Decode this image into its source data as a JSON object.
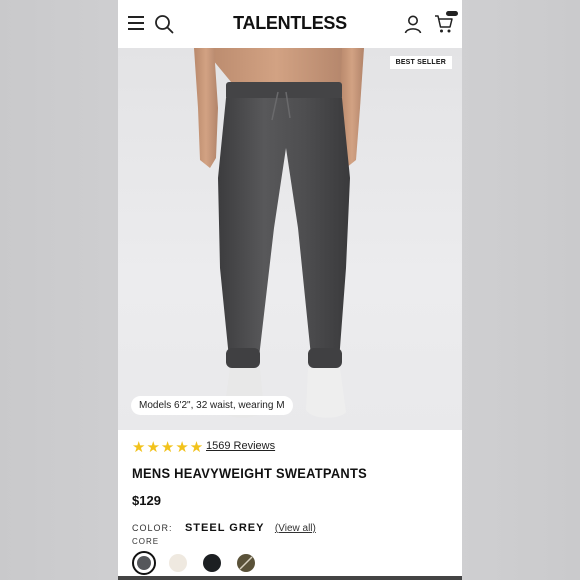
{
  "header": {
    "logo": "TALENTLESS",
    "menu_icon": "hamburger-icon",
    "search_icon": "search-icon",
    "account_icon": "account-icon",
    "cart_icon": "cart-icon"
  },
  "hero": {
    "badge": "BEST SELLER",
    "model_info": "Models 6'2\", 32 waist, wearing M"
  },
  "product": {
    "stars": "★★★★★",
    "rating": 5,
    "reviews_link": "1569 Reviews",
    "title": "MENS HEAVYWEIGHT SWEATPANTS",
    "price": "$129",
    "color_label": "COLOR:",
    "color_value": "STEEL GREY",
    "view_all": "(View all)",
    "collection_label": "CORE",
    "swatches": [
      {
        "name": "steel grey",
        "color": "#55575b",
        "selected": true
      },
      {
        "name": "cream",
        "color": "#efe9e0",
        "selected": false
      },
      {
        "name": "black",
        "color": "#1c1f22",
        "selected": false
      },
      {
        "name": "olive",
        "color": "#5a5239",
        "selected": false
      }
    ]
  },
  "colors": {
    "star": "#f2c21b",
    "pants": "#4a4a4c",
    "background": "#ffffff"
  }
}
